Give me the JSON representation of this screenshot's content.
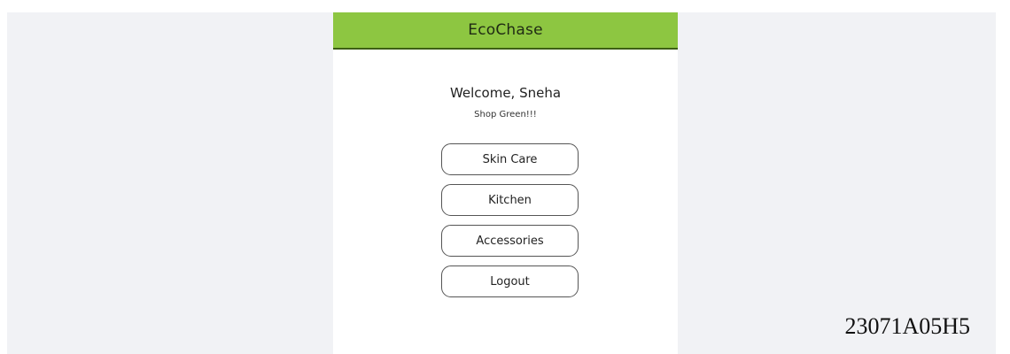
{
  "app": {
    "title": "EcoChase",
    "theme_color": "#8dc641"
  },
  "greeting": {
    "welcome": "Welcome, Sneha",
    "tagline": "Shop Green!!!"
  },
  "menu": [
    {
      "label": "Skin Care"
    },
    {
      "label": "Kitchen"
    },
    {
      "label": "Accessories"
    },
    {
      "label": "Logout"
    }
  ],
  "footer": {
    "student_id": "23071A05H5"
  }
}
